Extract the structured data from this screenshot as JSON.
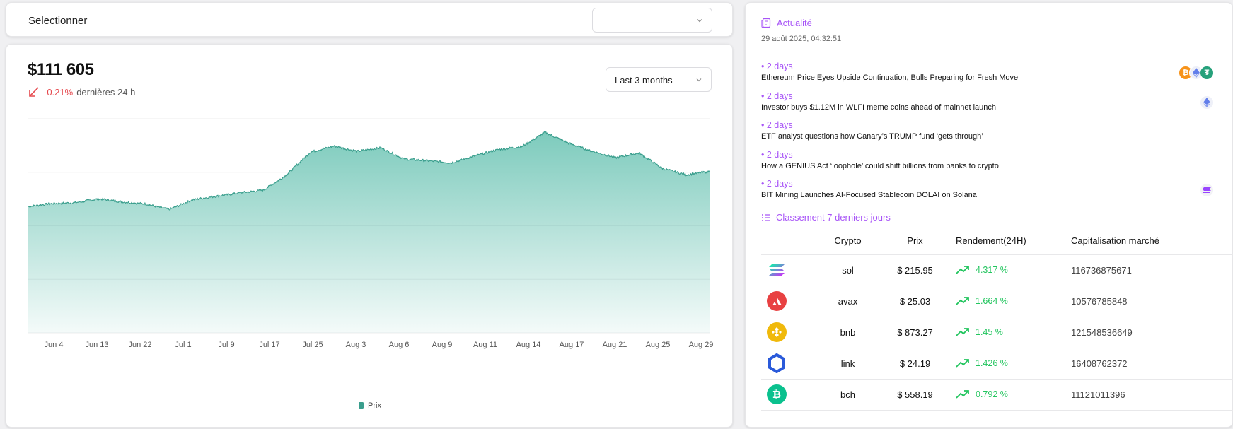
{
  "top": {
    "title": "Selectionner",
    "select_value": ""
  },
  "price_card": {
    "price": "$111 605",
    "change_pct": "-0.21%",
    "change_label": "dernières 24 h",
    "range_select": "Last 3 months"
  },
  "chart_data": {
    "type": "area",
    "x_ticks": [
      "Jun 4",
      "Jun 13",
      "Jun 22",
      "Jul 1",
      "Jul 9",
      "Jul 17",
      "Jul 25",
      "Aug 3",
      "Aug 6",
      "Aug 9",
      "Aug 11",
      "Aug 14",
      "Aug 17",
      "Aug 21",
      "Aug 25",
      "Aug 29"
    ],
    "series": [
      {
        "name": "Prix",
        "color": "#76c8b9",
        "values": [
          104500,
          105200,
          105400,
          106300,
          105600,
          105100,
          103800,
          106100,
          106900,
          107700,
          108300,
          111900,
          117200,
          118600,
          117400,
          118200,
          115600,
          115200,
          114700,
          116300,
          117800,
          118500,
          121800,
          119300,
          117400,
          115900,
          117000,
          113400,
          111900,
          112700
        ]
      }
    ],
    "legend": "bottom",
    "grid": true
  },
  "news": {
    "header": "Actualité",
    "date": "29 août 2025, 04:32:51",
    "items": [
      {
        "age": "• 2 days",
        "title": "Ethereum Price Eyes Upside Continuation, Bulls Preparing for Fresh Move",
        "icons": [
          "bitcoin-icon",
          "ethereum-icon",
          "tether-icon"
        ]
      },
      {
        "age": "• 2 days",
        "title": "Investor buys $1.12M in WLFI meme coins ahead of mainnet launch",
        "icons": [
          "ethereum-icon"
        ]
      },
      {
        "age": "• 2 days",
        "title": "ETF analyst questions how Canary’s TRUMP fund ‘gets through’",
        "icons": []
      },
      {
        "age": "• 2 days",
        "title": "How a GENIUS Act ‘loophole’ could shift billions from banks to crypto",
        "icons": []
      },
      {
        "age": "• 2 days",
        "title": "BIT Mining Launches AI-Focused Stablecoin DOLAI on Solana",
        "icons": [
          "solana-icon"
        ]
      }
    ]
  },
  "ranking": {
    "header": "Classement 7 derniers jours",
    "columns": [
      "",
      "Crypto",
      "Prix",
      "Rendement(24H)",
      "Capitalisation marché"
    ],
    "rows": [
      {
        "icon": "solana-icon",
        "name": "sol",
        "price": "$ 215.95",
        "return": "4.317 %",
        "cap": "116736875671"
      },
      {
        "icon": "avalanche-icon",
        "name": "avax",
        "price": "$ 25.03",
        "return": "1.664 %",
        "cap": "10576785848"
      },
      {
        "icon": "bnb-icon",
        "name": "bnb",
        "price": "$ 873.27",
        "return": "1.45 %",
        "cap": "121548536649"
      },
      {
        "icon": "chainlink-icon",
        "name": "link",
        "price": "$ 24.19",
        "return": "1.426 %",
        "cap": "16408762372"
      },
      {
        "icon": "bitcoin-cash-icon",
        "name": "bch",
        "price": "$ 558.19",
        "return": "0.792 %",
        "cap": "11121011396"
      }
    ]
  }
}
